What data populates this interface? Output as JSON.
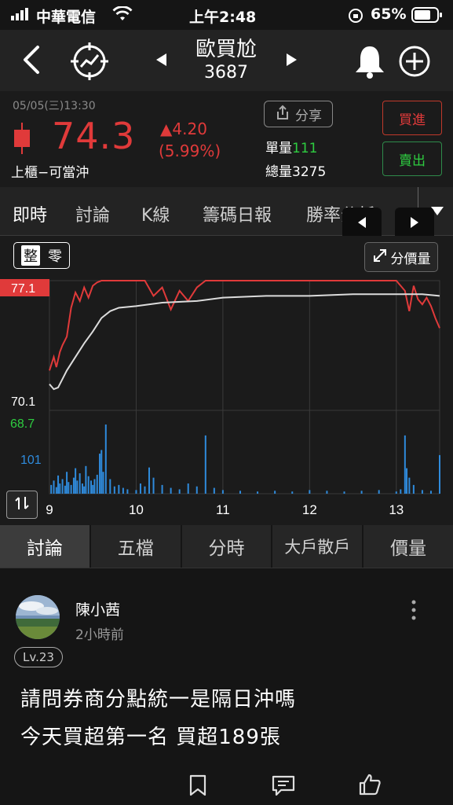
{
  "status": {
    "carrier": "中華電信",
    "time": "上午2:48",
    "battery": "65%"
  },
  "header": {
    "title": "歐買尬",
    "code": "3687",
    "icons": [
      "back-icon",
      "signal-icon",
      "prev-icon",
      "next-icon",
      "bell-icon",
      "add-icon"
    ]
  },
  "quote": {
    "datetime": "05/05(三)13:30",
    "price": "74.3",
    "change": "▲4.20",
    "change_pct": "(5.99%)",
    "market_label": "上櫃−可當沖",
    "share_label": "分享",
    "single_vol_label": "單量",
    "single_vol_value": "111",
    "total_vol_label": "總量",
    "total_vol_value": "3275",
    "buy_label": "買進",
    "sell_label": "賣出",
    "colors": {
      "up": "#e03a3a",
      "buy_border": "#c0392b",
      "sell_border": "#2e8b4a",
      "green_text": "#2ecc40"
    }
  },
  "tabs": {
    "items": [
      "即時",
      "討論",
      "K線",
      "籌碼日報",
      "勝率分析"
    ],
    "active": "即時"
  },
  "chart_controls": {
    "toggle_whole": "整",
    "toggle_odd": "零",
    "price_vol_label": "分價量"
  },
  "chart_data": {
    "type": "line",
    "x_ticks": [
      "9",
      "10",
      "11",
      "12",
      "13"
    ],
    "price_axis": {
      "high_label": "77.1",
      "low_label": "70.1",
      "ylim": [
        70.1,
        77.1
      ]
    },
    "volume_axis": {
      "ref_label": "101",
      "low_label": "68.7"
    },
    "series": [
      {
        "color": "#e03a3a",
        "x": [
          9.0,
          9.05,
          9.08,
          9.12,
          9.15,
          9.2,
          9.25,
          9.3,
          9.35,
          9.4,
          9.45,
          9.5,
          9.55,
          9.6,
          9.7,
          9.8,
          10.0,
          10.1,
          10.2,
          10.3,
          10.4,
          10.5,
          10.6,
          10.7,
          10.8,
          11.0,
          11.5,
          12.0,
          12.5,
          13.0,
          13.1,
          13.15,
          13.2,
          13.25,
          13.3,
          13.35,
          13.4,
          13.45,
          13.5
        ],
        "values": [
          71.8,
          72.6,
          72.0,
          72.9,
          73.3,
          73.8,
          75.5,
          76.4,
          75.9,
          76.7,
          76.1,
          76.8,
          77.0,
          77.1,
          77.1,
          77.1,
          77.1,
          77.1,
          76.2,
          76.7,
          75.4,
          76.5,
          75.9,
          76.7,
          77.1,
          77.1,
          77.1,
          77.1,
          77.1,
          77.1,
          76.5,
          75.3,
          76.8,
          76.0,
          75.7,
          76.1,
          75.6,
          74.9,
          74.3
        ]
      },
      {
        "color": "#dcdcdc",
        "x": [
          9.0,
          9.05,
          9.1,
          9.15,
          9.2,
          9.3,
          9.4,
          9.5,
          9.6,
          9.7,
          9.8,
          10.0,
          10.3,
          10.7,
          11.0,
          11.5,
          12.0,
          12.5,
          13.0,
          13.3,
          13.5
        ],
        "values": [
          71.0,
          70.7,
          70.8,
          71.3,
          71.8,
          72.6,
          73.4,
          74.1,
          74.9,
          75.3,
          75.5,
          75.6,
          75.8,
          75.9,
          76.1,
          76.2,
          76.2,
          76.3,
          76.3,
          76.3,
          76.2
        ]
      }
    ],
    "volume": {
      "color": "#2f8bdc",
      "x": [
        9.02,
        9.05,
        9.08,
        9.1,
        9.12,
        9.15,
        9.18,
        9.2,
        9.22,
        9.25,
        9.28,
        9.3,
        9.32,
        9.35,
        9.38,
        9.4,
        9.42,
        9.45,
        9.48,
        9.5,
        9.52,
        9.55,
        9.58,
        9.6,
        9.62,
        9.65,
        9.7,
        9.75,
        9.8,
        9.85,
        9.9,
        10.0,
        10.05,
        10.1,
        10.15,
        10.2,
        10.3,
        10.4,
        10.5,
        10.6,
        10.7,
        10.8,
        10.9,
        11.0,
        11.2,
        11.4,
        11.6,
        11.8,
        12.0,
        12.2,
        12.4,
        12.6,
        12.8,
        13.0,
        13.05,
        13.1,
        13.12,
        13.15,
        13.2,
        13.3,
        13.4,
        13.5
      ],
      "values": [
        12,
        18,
        9,
        25,
        14,
        20,
        11,
        30,
        16,
        12,
        22,
        35,
        18,
        28,
        14,
        10,
        38,
        24,
        18,
        12,
        20,
        26,
        55,
        60,
        30,
        95,
        20,
        10,
        12,
        8,
        6,
        5,
        14,
        10,
        36,
        22,
        12,
        8,
        6,
        14,
        10,
        80,
        8,
        5,
        4,
        3,
        4,
        3,
        5,
        4,
        3,
        4,
        5,
        3,
        6,
        80,
        35,
        22,
        12,
        5,
        4,
        53
      ]
    }
  },
  "bottom_tabs": {
    "items": [
      "討論",
      "五檔",
      "分時",
      "大戶散戶",
      "價量"
    ],
    "active": "討論"
  },
  "post": {
    "user": "陳小茜",
    "time": "2小時前",
    "level": "Lv.23",
    "line1": "請問券商分點統一是隔日沖嗎",
    "line2": "今天買超第一名  買超189張",
    "icons": [
      "bookmark-icon",
      "comment-icon",
      "like-icon",
      "more-icon"
    ]
  }
}
